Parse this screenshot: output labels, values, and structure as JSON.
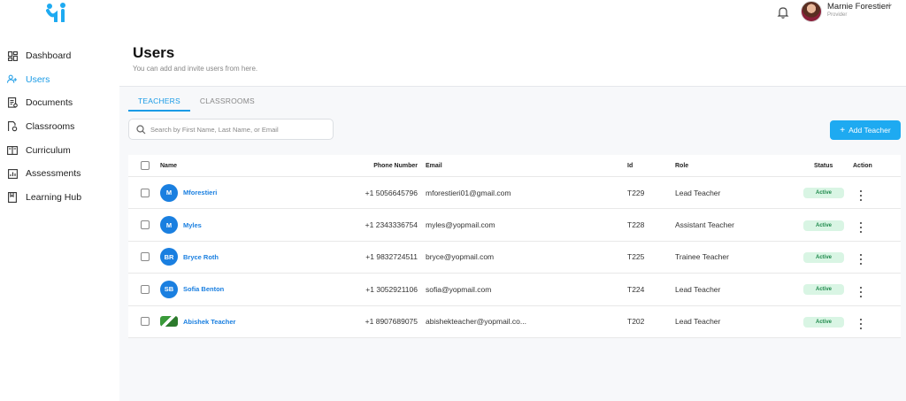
{
  "sidebar": {
    "items": [
      {
        "label": "Dashboard",
        "icon": "dashboard-icon"
      },
      {
        "label": "Users",
        "icon": "users-icon",
        "active": true
      },
      {
        "label": "Documents",
        "icon": "documents-icon"
      },
      {
        "label": "Classrooms",
        "icon": "classrooms-icon"
      },
      {
        "label": "Curriculum",
        "icon": "curriculum-icon"
      },
      {
        "label": "Assessments",
        "icon": "assessments-icon"
      },
      {
        "label": "Learning Hub",
        "icon": "learning-hub-icon"
      }
    ]
  },
  "topbar": {
    "user_name": "Marnie Forestieri",
    "user_role": "Provider"
  },
  "header": {
    "title": "Users",
    "subtitle": "You can add and invite users from here."
  },
  "tabs": [
    {
      "label": "TEACHERS",
      "active": true
    },
    {
      "label": "CLASSROOMS",
      "active": false
    }
  ],
  "search": {
    "placeholder": "Search by First Name, Last Name, or Email",
    "value": ""
  },
  "add_button": {
    "label": "Add Teacher"
  },
  "table": {
    "columns": {
      "name": "Name",
      "phone": "Phone Number",
      "email": "Email",
      "id": "Id",
      "role": "Role",
      "status": "Status",
      "action": "Action"
    },
    "rows": [
      {
        "initials": "M",
        "name": "Mforestieri",
        "phone": "+1 5056645796",
        "email": "mforestieri01@gmail.com",
        "id": "T229",
        "role": "Lead Teacher",
        "status": "Active"
      },
      {
        "initials": "M",
        "name": "Myles",
        "phone": "+1 2343336754",
        "email": "myles@yopmail.com",
        "id": "T228",
        "role": "Assistant Teacher",
        "status": "Active"
      },
      {
        "initials": "BR",
        "name": "Bryce Roth",
        "phone": "+1 9832724511",
        "email": "bryce@yopmail.com",
        "id": "T225",
        "role": "Trainee Teacher",
        "status": "Active"
      },
      {
        "initials": "SB",
        "name": "Sofia Benton",
        "phone": "+1 3052921106",
        "email": "sofia@yopmail.com",
        "id": "T224",
        "role": "Lead Teacher",
        "status": "Active"
      },
      {
        "initials": "",
        "name": "Abishek Teacher",
        "phone": "+1 8907689075",
        "email": "abishekteacher@yopmail.co...",
        "id": "T202",
        "role": "Lead Teacher",
        "status": "Active",
        "photo": true
      }
    ]
  },
  "colors": {
    "accent": "#1a9be6",
    "button": "#1eaaf1",
    "avatar": "#1a7fe0",
    "status_bg": "#d9f5e4",
    "status_text": "#1f8a4c"
  }
}
